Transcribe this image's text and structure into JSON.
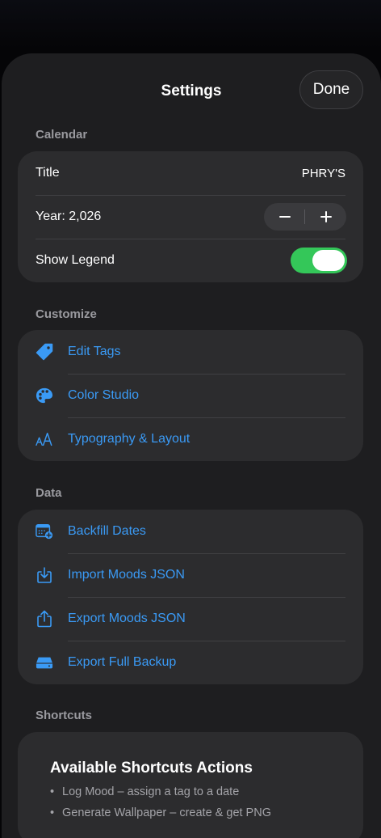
{
  "sheet": {
    "title": "Settings",
    "done_label": "Done"
  },
  "calendar": {
    "header": "Calendar",
    "title_label": "Title",
    "title_value": "PHRY'S",
    "year_label": "Year: 2,026",
    "stepper": {
      "minus": "−",
      "plus": "+"
    },
    "legend_label": "Show Legend",
    "legend_on": true
  },
  "customize": {
    "header": "Customize",
    "items": [
      {
        "label": "Edit Tags",
        "icon": "tag-icon"
      },
      {
        "label": "Color Studio",
        "icon": "palette-icon"
      },
      {
        "label": "Typography & Layout",
        "icon": "textformat-icon"
      }
    ]
  },
  "data_section": {
    "header": "Data",
    "items": [
      {
        "label": "Backfill Dates",
        "icon": "calendar-plus-icon"
      },
      {
        "label": "Import Moods JSON",
        "icon": "import-icon"
      },
      {
        "label": "Export Moods JSON",
        "icon": "share-icon"
      },
      {
        "label": "Export Full Backup",
        "icon": "drive-icon"
      }
    ]
  },
  "shortcuts": {
    "header": "Shortcuts",
    "card_title": "Available Shortcuts Actions",
    "bullet": "•",
    "items": [
      "Log Mood – assign a tag to a date",
      "Generate Wallpaper – create & get PNG"
    ]
  },
  "colors": {
    "accent": "#3a9af5",
    "toggle_on": "#34c759",
    "card": "#2c2c2e",
    "sheet": "#1e1e20"
  }
}
